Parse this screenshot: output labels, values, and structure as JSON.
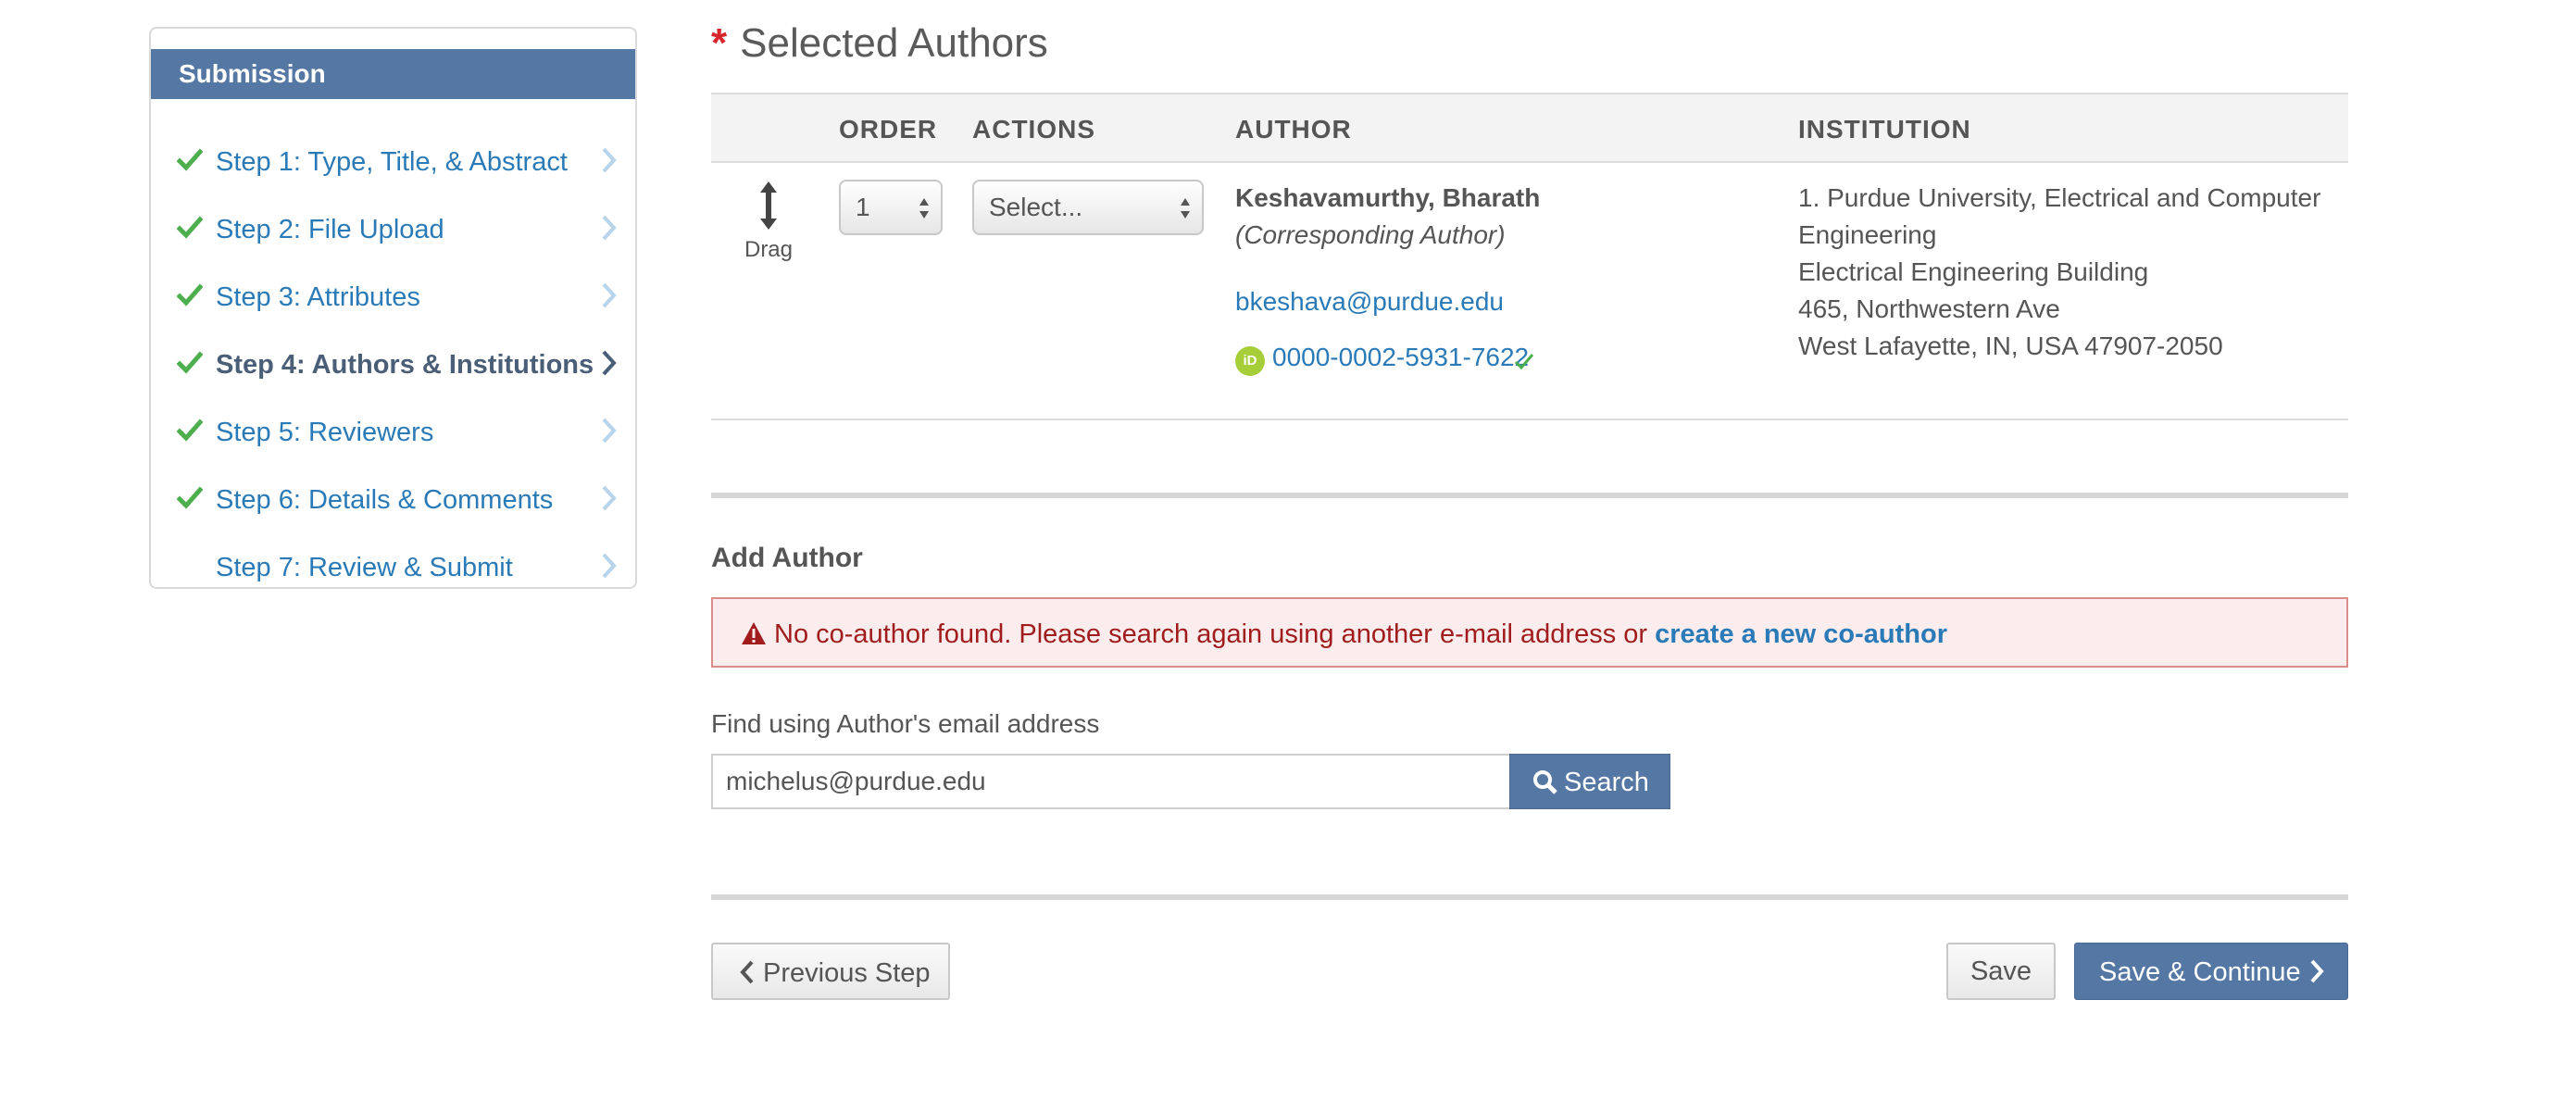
{
  "sidebar": {
    "title": "Submission",
    "steps": [
      {
        "label": "Step 1: Type, Title, & Abstract",
        "completed": true,
        "active": false
      },
      {
        "label": "Step 2: File Upload",
        "completed": true,
        "active": false
      },
      {
        "label": "Step 3: Attributes",
        "completed": true,
        "active": false
      },
      {
        "label": "Step 4: Authors & Institutions",
        "completed": true,
        "active": true
      },
      {
        "label": "Step 5: Reviewers",
        "completed": true,
        "active": false
      },
      {
        "label": "Step 6: Details & Comments",
        "completed": true,
        "active": false
      },
      {
        "label": "Step 7: Review & Submit",
        "completed": false,
        "active": false
      }
    ]
  },
  "selected_authors": {
    "required_marker": "*",
    "title": "Selected Authors",
    "columns": [
      "ORDER",
      "ACTIONS",
      "AUTHOR",
      "INSTITUTION"
    ],
    "rows": [
      {
        "drag_label": "Drag",
        "order": "1",
        "action": "Select...",
        "name": "Keshavamurthy, Bharath",
        "role": "(Corresponding Author)",
        "email": "bkeshava@purdue.edu",
        "orcid_badge": "iD",
        "orcid": "0000-0002-5931-7622",
        "institution_lines": [
          "1. Purdue University, Electrical and Computer",
          "Engineering",
          "Electrical Engineering Building",
          "465, Northwestern Ave",
          "West Lafayette, IN, USA 47907-2050"
        ]
      }
    ]
  },
  "add_author": {
    "title": "Add Author",
    "alert_text": "No co-author found. Please search again using another e-mail address or",
    "alert_link": "create a new co-author",
    "find_label": "Find using Author's email address",
    "email_value": "michelus@purdue.edu",
    "search_label": "Search"
  },
  "footer": {
    "previous_label": "Previous Step",
    "save_label": "Save",
    "continue_label": "Save & Continue"
  },
  "colors": {
    "accent": "#5577a3",
    "link": "#2a7ab8",
    "check": "#4cae4c",
    "error": "#a11d1d",
    "required": "#d9262d"
  },
  "icons": {
    "check": "check-icon",
    "chevron": "chevron-right-icon",
    "drag": "drag-vertical-icon",
    "orcid": "orcid-icon",
    "warning": "warning-icon",
    "search": "search-icon"
  }
}
